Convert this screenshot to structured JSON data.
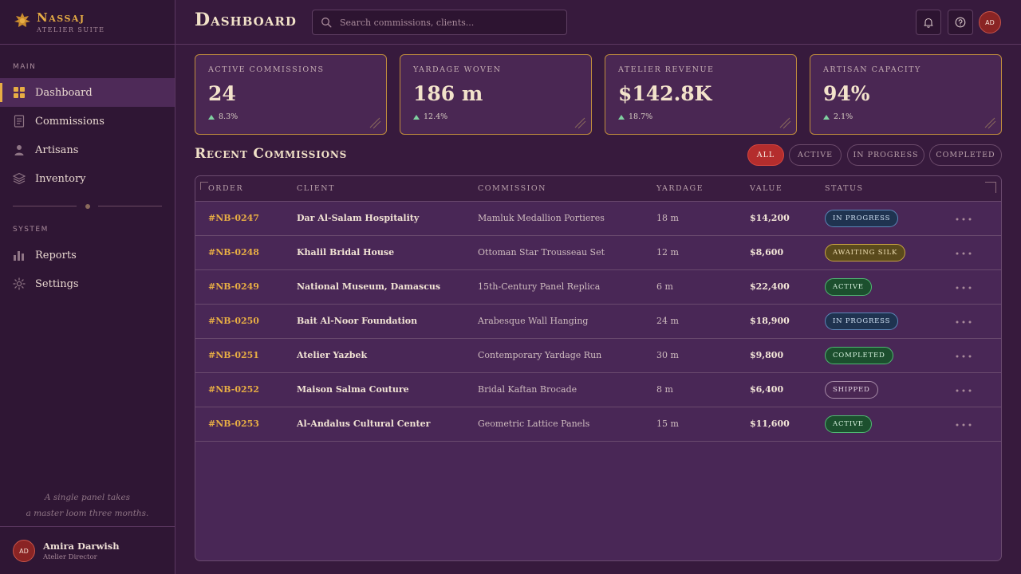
{
  "brand": {
    "name": "Nassaj",
    "subtitle": "Atelier Suite"
  },
  "sidebar": {
    "main_label": "Main",
    "system_label": "System",
    "main_items": [
      {
        "label": "Dashboard",
        "icon": "grid-icon",
        "active": true
      },
      {
        "label": "Commissions",
        "icon": "document-icon",
        "active": false
      },
      {
        "label": "Artisans",
        "icon": "person-icon",
        "active": false
      },
      {
        "label": "Inventory",
        "icon": "layers-icon",
        "active": false
      }
    ],
    "system_items": [
      {
        "label": "Reports",
        "icon": "bar-chart-icon"
      },
      {
        "label": "Settings",
        "icon": "gear-icon"
      }
    ],
    "quote_line1": "A single panel takes",
    "quote_line2": "a master loom three months."
  },
  "user": {
    "initials": "AD",
    "name": "Amira Darwish",
    "role": "Atelier Director"
  },
  "header": {
    "title": "Dashboard",
    "search_placeholder": "Search commissions, clients..."
  },
  "stats": [
    {
      "label": "Active Commissions",
      "value": "24",
      "delta": "8.3%"
    },
    {
      "label": "Yardage Woven",
      "value": "186 m",
      "delta": "12.4%"
    },
    {
      "label": "Atelier Revenue",
      "value": "$142.8K",
      "delta": "18.7%"
    },
    {
      "label": "Artisan Capacity",
      "value": "94%",
      "delta": "2.1%"
    }
  ],
  "recent": {
    "title": "Recent Commissions",
    "filters": [
      "All",
      "Active",
      "In Progress",
      "Completed"
    ],
    "active_filter": "All",
    "columns": [
      "Order",
      "Client",
      "Commission",
      "Yardage",
      "Value",
      "Status"
    ],
    "rows": [
      {
        "order": "#NB-0247",
        "client": "Dar Al-Salam Hospitality",
        "commission": "Mamluk Medallion Portieres",
        "yardage": "18 m",
        "value": "$14,200",
        "status": "In Progress"
      },
      {
        "order": "#NB-0248",
        "client": "Khalil Bridal House",
        "commission": "Ottoman Star Trousseau Set",
        "yardage": "12 m",
        "value": "$8,600",
        "status": "Awaiting Silk"
      },
      {
        "order": "#NB-0249",
        "client": "National Museum, Damascus",
        "commission": "15th-Century Panel Replica",
        "yardage": "6 m",
        "value": "$22,400",
        "status": "Active"
      },
      {
        "order": "#NB-0250",
        "client": "Bait Al-Noor Foundation",
        "commission": "Arabesque Wall Hanging",
        "yardage": "24 m",
        "value": "$18,900",
        "status": "In Progress"
      },
      {
        "order": "#NB-0251",
        "client": "Atelier Yazbek",
        "commission": "Contemporary Yardage Run",
        "yardage": "30 m",
        "value": "$9,800",
        "status": "Completed"
      },
      {
        "order": "#NB-0252",
        "client": "Maison Salma Couture",
        "commission": "Bridal Kaftan Brocade",
        "yardage": "8 m",
        "value": "$6,400",
        "status": "Shipped"
      },
      {
        "order": "#NB-0253",
        "client": "Al-Andalus Cultural Center",
        "commission": "Geometric Lattice Panels",
        "yardage": "15 m",
        "value": "$11,600",
        "status": "Active"
      }
    ]
  },
  "colors": {
    "accent_gold": "#e7ad44",
    "filter_active": "#b42d2d",
    "status_in_progress": "#1f3350",
    "status_awaiting_silk": "#5a4a1c",
    "status_active": "#1c4f2e",
    "status_completed": "#1c4f2e",
    "status_shipped": "#4a2753"
  }
}
